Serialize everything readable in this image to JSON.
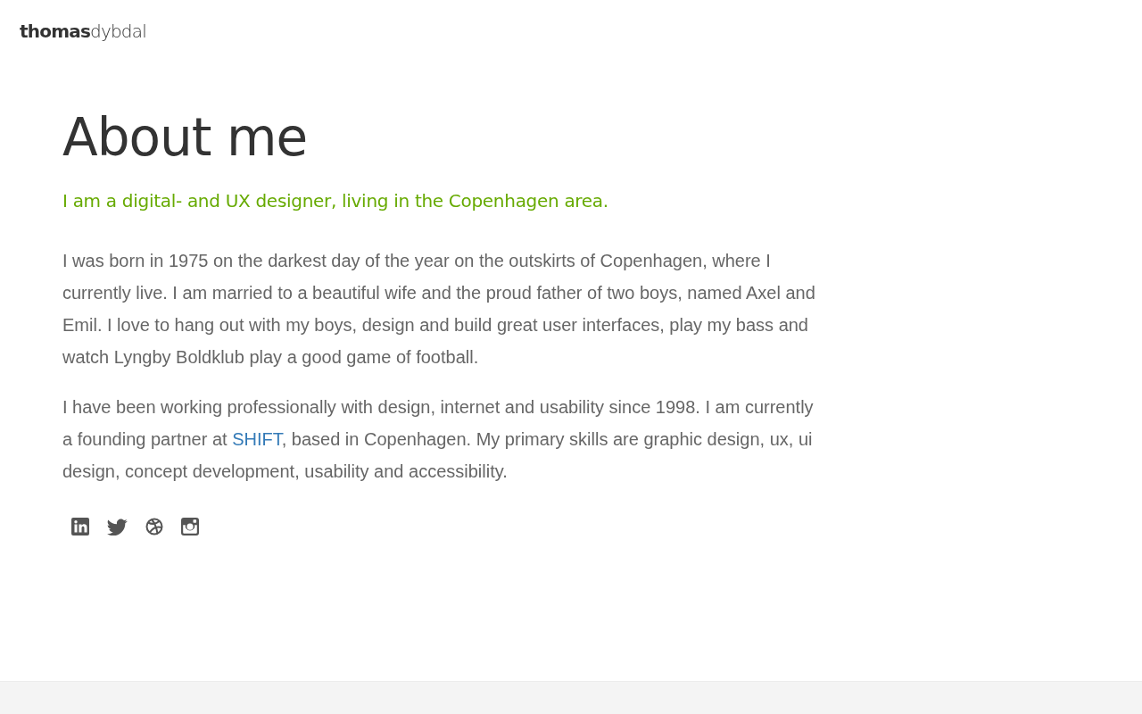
{
  "header": {
    "logo": "**thomas**dybdal"
  },
  "main": {
    "title": "About me",
    "subtitle": "I am a digital- and UX designer, living in the Copenhagen area.",
    "paragraphs": [
      {
        "parts": [
          {
            "kind": "text",
            "text": "I was born in 1975 on the darkest day of the year on the outskirts of Copenhagen, where I currently live. I am married to a beautiful wife and the proud father of two boys, named Axel and Emil. I love to hang out with my boys, design and build great user interfaces, play my bass and watch Lyngby Boldklub play a good game of football."
          }
        ]
      },
      {
        "parts": [
          {
            "kind": "text",
            "text": "I have been working professionally with design, internet and usability since 1998. I am currently a founding partner at "
          },
          {
            "kind": "link",
            "text": "SHIFT"
          },
          {
            "kind": "text",
            "text": ", based in Copenhagen. My primary skills are graphic design, ux, ui design, concept development, usability and accessibility."
          }
        ]
      }
    ],
    "social_links": [
      {
        "kind": "linkedin"
      },
      {
        "kind": "twitter"
      },
      {
        "kind": "dribbble"
      },
      {
        "kind": "instagram"
      }
    ]
  }
}
